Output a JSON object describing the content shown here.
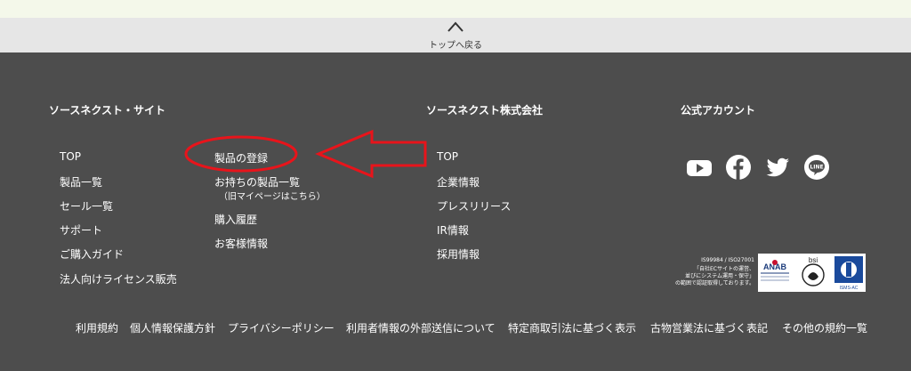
{
  "back_to_top": {
    "label": "トップへ戻る"
  },
  "col_site": {
    "heading": "ソースネクスト・サイト",
    "links": [
      "TOP",
      "製品一覧",
      "セール一覧",
      "サポート",
      "ご購入ガイド",
      "法人向けライセンス販売"
    ]
  },
  "col_account": {
    "links": [
      "製品の登録",
      "お持ちの製品一覧",
      "購入履歴",
      "お客様情報"
    ],
    "sublink": "（旧マイページはこちら）"
  },
  "col_company": {
    "heading": "ソースネクスト株式会社",
    "links": [
      "TOP",
      "企業情報",
      "プレスリリース",
      "IR情報",
      "採用情報"
    ]
  },
  "col_social": {
    "heading": "公式アカウント",
    "icons": [
      "youtube-icon",
      "facebook-icon",
      "twitter-icon",
      "line-icon"
    ]
  },
  "certification": {
    "line1": "IS99984 / ISO27001",
    "line2": "「自社ECサイトの運営、",
    "line3": "並びにシステム運用・保守」",
    "line4": "の範囲で認証取得しております。",
    "anab": "ANAB",
    "bsi": "bsi",
    "isms": "ISMS-AC"
  },
  "bottom_nav": [
    "利用規約",
    "個人情報保護方針",
    "プライバシーポリシー",
    "利用者情報の外部送信について",
    "特定商取引法に基づく表示",
    "古物営業法に基づく表記",
    "その他の規約一覧"
  ],
  "colors": {
    "footer_bg": "#4d4d4d",
    "annotation_red": "#e8141b"
  }
}
